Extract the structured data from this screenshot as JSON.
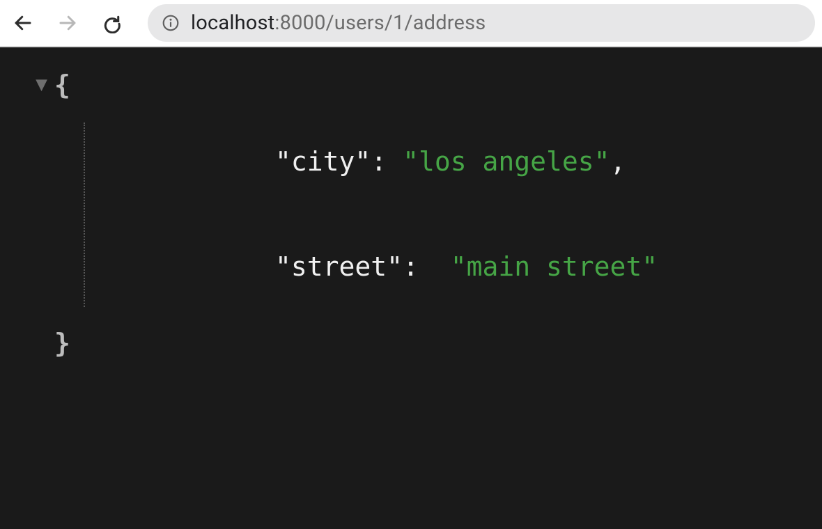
{
  "address_bar": {
    "host": "localhost",
    "rest": ":8000/users/1/address"
  },
  "json": {
    "open_brace": "{",
    "close_brace": "}",
    "entries": [
      {
        "key": "\"city\"",
        "sep": ": ",
        "value": "\"los angeles\"",
        "trail": ","
      },
      {
        "key": "\"street\"",
        "sep": ":  ",
        "value": "\"main street\"",
        "trail": ""
      }
    ]
  },
  "icons": {
    "toggle": "▼"
  }
}
